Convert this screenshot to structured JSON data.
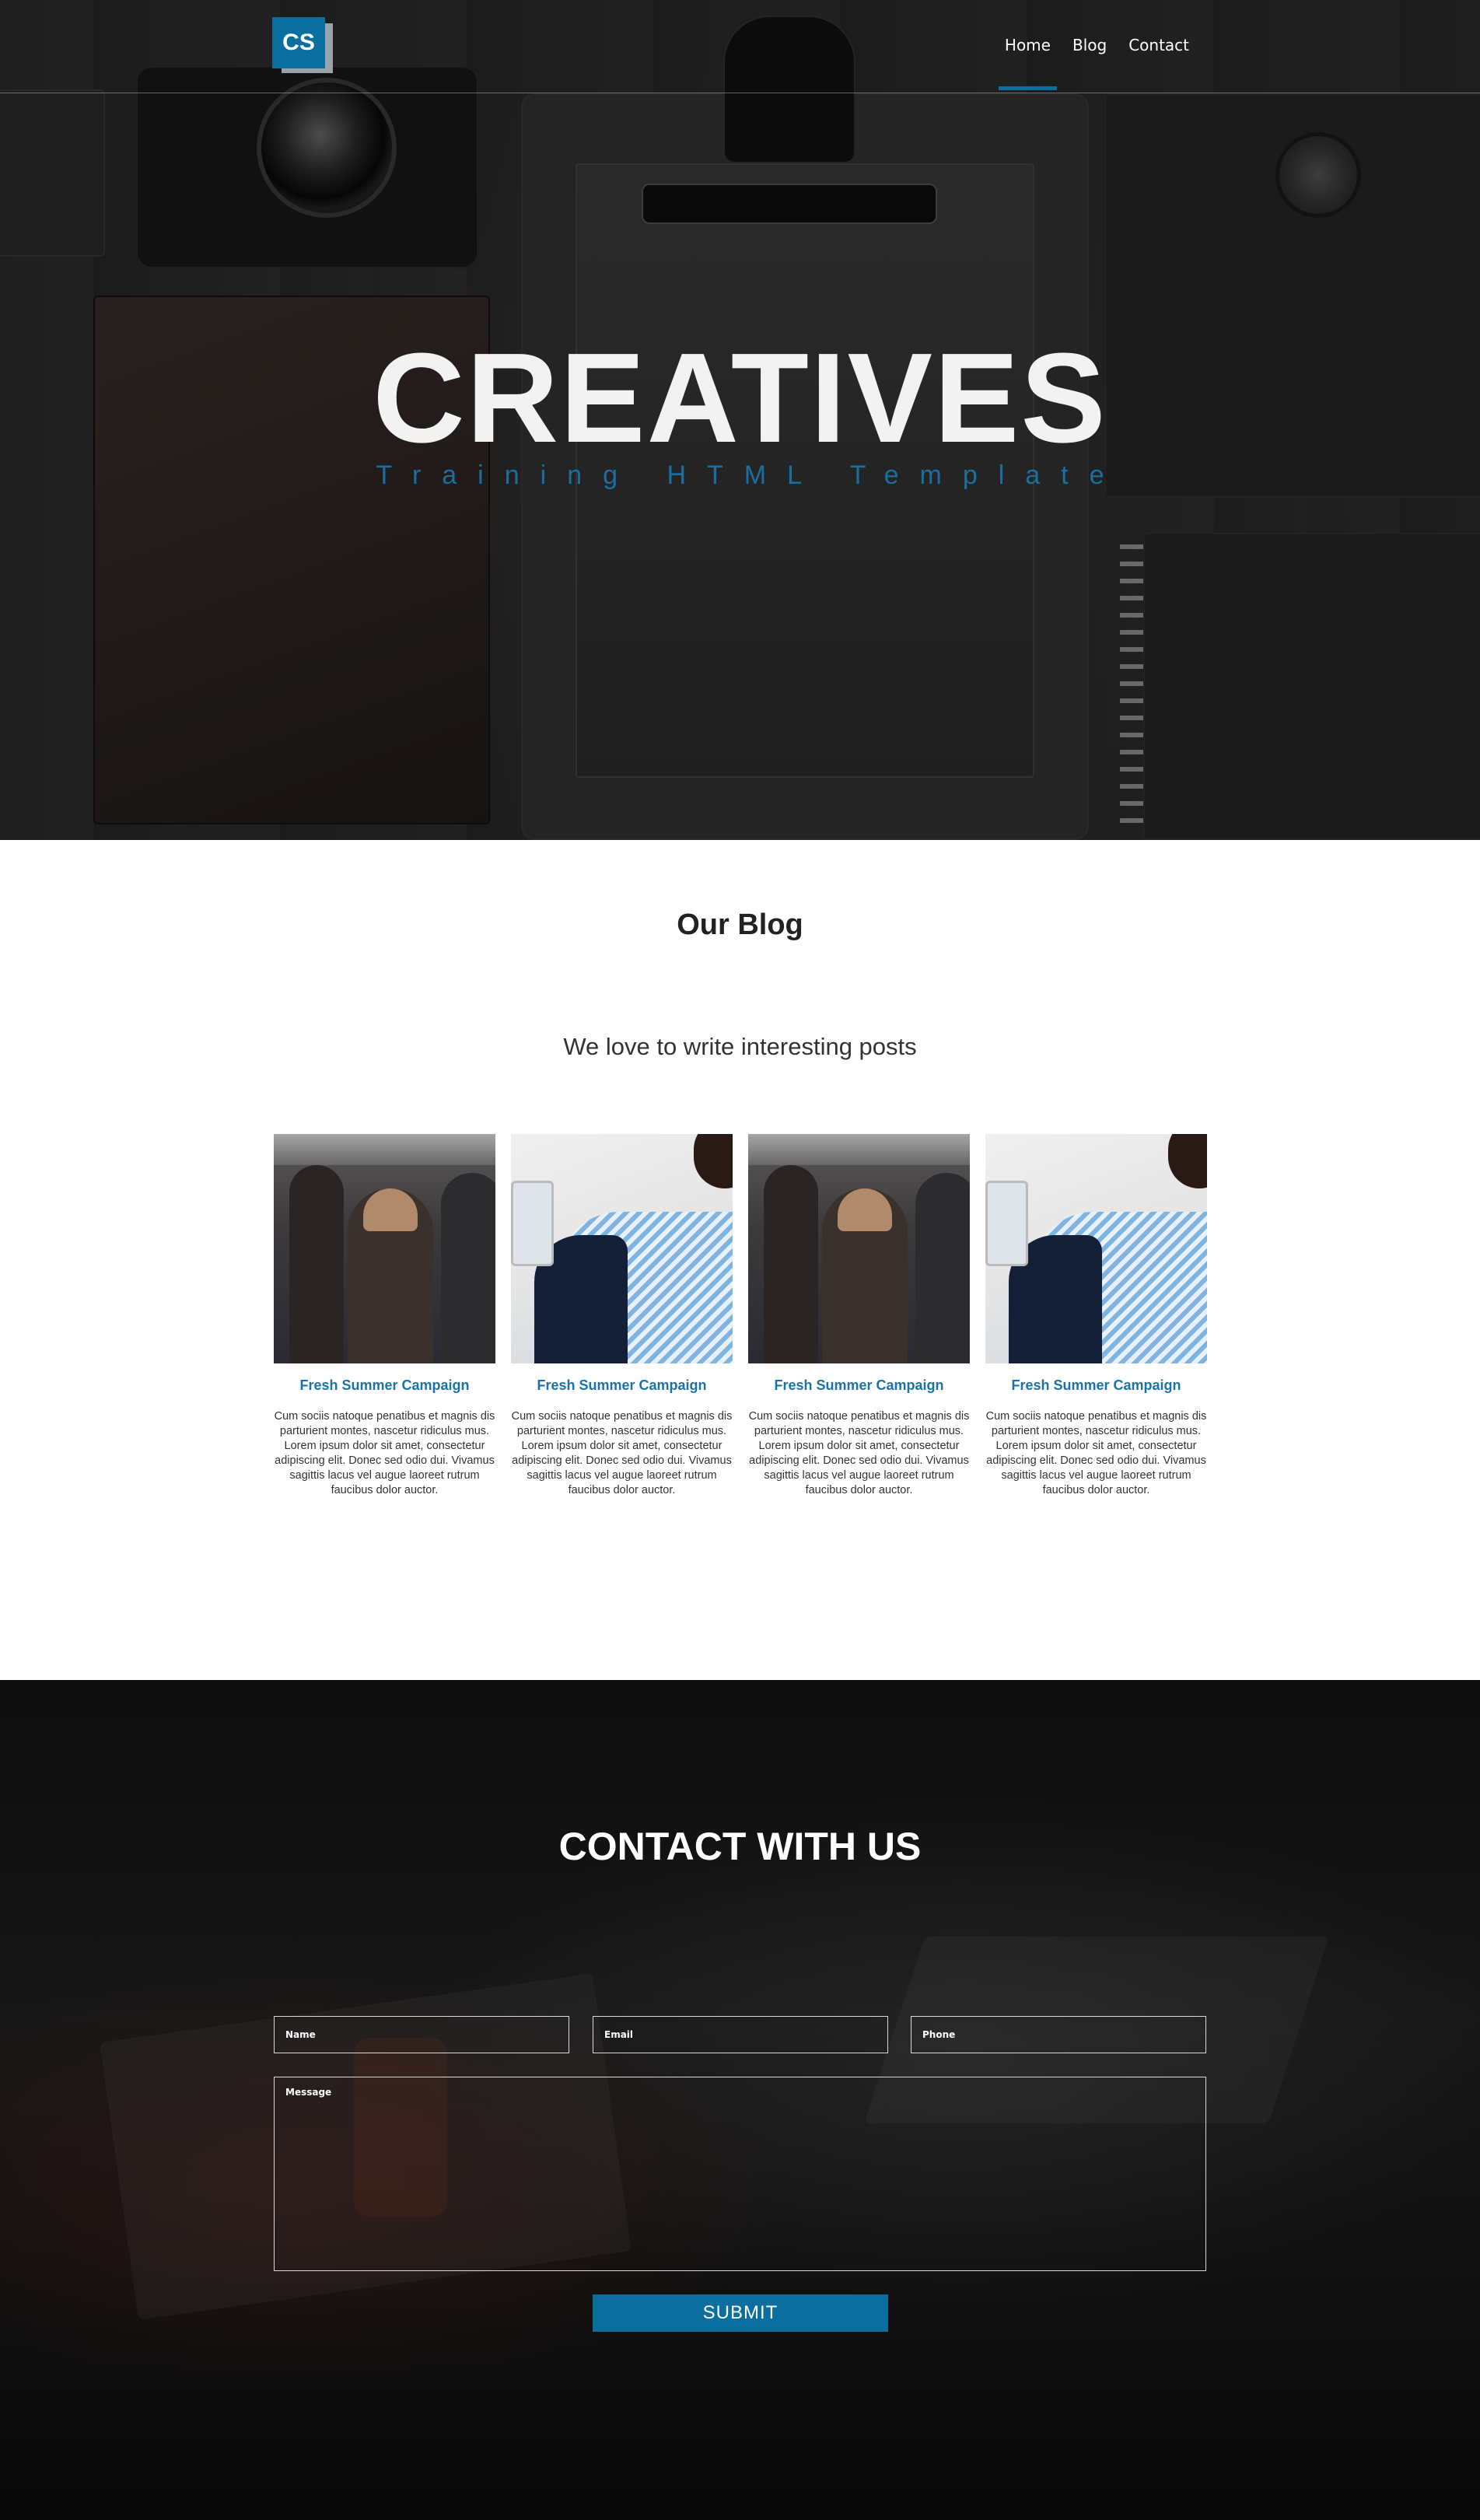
{
  "brand": {
    "logo_text": "CS",
    "accent_color": "#0a6f9e"
  },
  "nav": {
    "items": [
      {
        "label": "Home",
        "active": true
      },
      {
        "label": "Blog",
        "active": false
      },
      {
        "label": "Contact",
        "active": false
      }
    ]
  },
  "hero": {
    "title": "CREATIVES",
    "subtitle": "Training HTML Template"
  },
  "blog": {
    "title": "Our Blog",
    "subtitle": "We love to write interesting posts",
    "posts": [
      {
        "image": "team-photo",
        "title": "Fresh Summer Campaign",
        "text": "Cum sociis natoque penatibus et magnis dis parturient montes, nascetur ridiculus mus. Lorem ipsum dolor sit amet, consectetur adipiscing elit. Donec sed odio dui. Vivamus sagittis lacus vel augue laoreet rutrum faucibus dolor auctor."
      },
      {
        "image": "business-photo",
        "title": "Fresh Summer Campaign",
        "text": "Cum sociis natoque penatibus et magnis dis parturient montes, nascetur ridiculus mus. Lorem ipsum dolor sit amet, consectetur adipiscing elit. Donec sed odio dui. Vivamus sagittis lacus vel augue laoreet rutrum faucibus dolor auctor."
      },
      {
        "image": "team-photo",
        "title": "Fresh Summer Campaign",
        "text": "Cum sociis natoque penatibus et magnis dis parturient montes, nascetur ridiculus mus. Lorem ipsum dolor sit amet, consectetur adipiscing elit. Donec sed odio dui. Vivamus sagittis lacus vel augue laoreet rutrum faucibus dolor auctor."
      },
      {
        "image": "business-photo",
        "title": "Fresh Summer Campaign",
        "text": "Cum sociis natoque penatibus et magnis dis parturient montes, nascetur ridiculus mus. Lorem ipsum dolor sit amet, consectetur adipiscing elit. Donec sed odio dui. Vivamus sagittis lacus vel augue laoreet rutrum faucibus dolor auctor."
      }
    ]
  },
  "contact": {
    "title": "CONTACT WITH US",
    "fields": {
      "name_placeholder": "Name",
      "email_placeholder": "Email",
      "phone_placeholder": "Phone",
      "message_placeholder": "Message"
    },
    "submit_label": "SUBMIT"
  }
}
